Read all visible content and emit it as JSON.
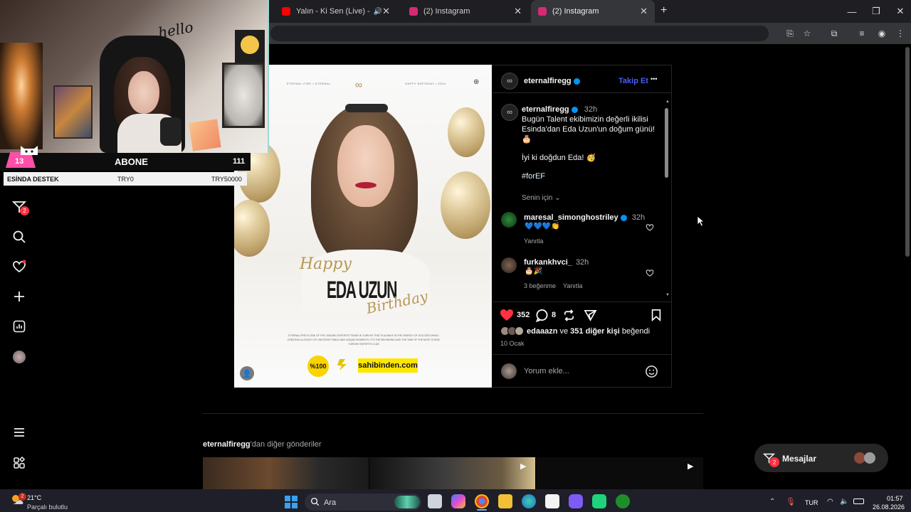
{
  "tabs": [
    {
      "title": "Yalın - Ki Sen (Live) - YouTube",
      "favicon_color": "#ff0000",
      "active": false
    },
    {
      "title": "(2) Instagram",
      "favicon_color": "#d62976",
      "active": false
    },
    {
      "title": "(2) Instagram",
      "favicon_color": "#d62976",
      "active": true
    }
  ],
  "window_controls": {
    "minimize": "—",
    "restore": "❐",
    "close": "✕"
  },
  "new_tab": "+",
  "sidebar": {
    "icons": [
      "home-icon",
      "explore-icon",
      "direct-icon",
      "search-icon",
      "heart-icon",
      "create-icon",
      "insights-icon",
      "profile-avatar",
      "menu-icon",
      "more-icon"
    ],
    "direct_badge": "2"
  },
  "post": {
    "username": "eternalfiregg",
    "follow_label": "Takip Et",
    "more_label": "•••",
    "caption_user": "eternalfiregg",
    "caption_time": "32h",
    "caption_text": "Bugün Talent ekibimizin değerli ikilisi Esinda'dan Eda Uzun'un doğum günü! 🎂",
    "caption_line2": "İyi ki doğdun Eda! 🥳",
    "hashtag": "#forEF",
    "filter_label": "Senin için",
    "comments": [
      {
        "user": "maresal_simonghostriley",
        "verified": true,
        "time": "32h",
        "text": "💙💙💙👏",
        "reply_label": "Yanıtla",
        "likes_label": ""
      },
      {
        "user": "furkankhvci_",
        "verified": false,
        "time": "32h",
        "text": "🎂🎉",
        "reply_label": "Yanıtla",
        "likes_label": "3 beğenme"
      }
    ],
    "like_count": "352",
    "comment_count": "8",
    "liked_by_prefix": "edaaazn",
    "liked_by_mid": " ve ",
    "liked_by_count": "351 diğer kişi",
    "liked_by_suffix": " beğendi",
    "date": "10 Ocak",
    "comment_placeholder": "Yorum ekle..."
  },
  "poster": {
    "top_left": "ETERNAL FIRE  •  ETERNAL",
    "top_right": "HAPPY BIRTHDAY  •  2024",
    "happy": "Happy",
    "name": "EDA UZUN",
    "birthday": "Birthday",
    "blurb": "ETERNAL FIRE IS ONE OF THE LEADING ESPORTS TEAMS IN TURKIYE THAT IS ALWAYS IN THE SEARCH OF SUCCESS WHILE CREATING A LEGACY OF UNFORGETTABLE AND UNIQUE MOMENTS. IT'S THE BEGINNING AND THE TIME OF THE MOST ICONIC TURKISH ESPORTS CLUB",
    "sponsor_1": "%100",
    "sponsor_3": "sahibinden.com"
  },
  "more_posts_user": "eternalfiregg",
  "more_posts_suffix": "'dan diğer gönderiler",
  "messages_label": "Mesajlar",
  "messages_badge": "2",
  "overlay": {
    "handwriting": "hello",
    "sub_count": "13",
    "sub_label": "ABONE",
    "sub_total": "111",
    "donation_label": "ESİNDA DESTEK",
    "donation_min": "TRY0",
    "donation_max": "TRY50000"
  },
  "taskbar": {
    "weather_temp": "21°C",
    "weather_desc": "Parçalı bulutlu",
    "search_label": "Ara",
    "lang": "TUR",
    "time": "01:57",
    "date": "26.08.2026"
  }
}
